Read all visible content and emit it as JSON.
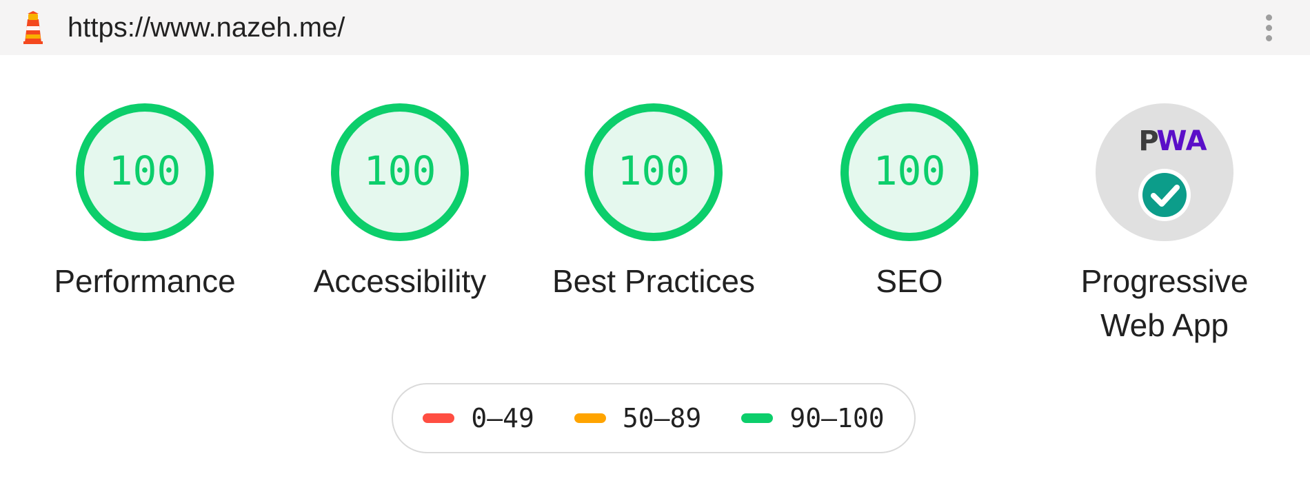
{
  "header": {
    "url": "https://www.nazeh.me/",
    "logo_icon": "lighthouse-icon",
    "menu_icon": "more-vertical-icon"
  },
  "colors": {
    "pass": "#0cce6b",
    "pass_fill": "#e5f8ee",
    "average": "#ffa400",
    "fail": "#ff4e42",
    "pwa_gray": "#e0e0e0"
  },
  "gauges": [
    {
      "label": "Performance",
      "score": "100"
    },
    {
      "label": "Accessibility",
      "score": "100"
    },
    {
      "label": "Best Practices",
      "score": "100"
    },
    {
      "label": "SEO",
      "score": "100"
    }
  ],
  "pwa": {
    "label_line1": "Progressive",
    "label_line2": "Web App",
    "badge_text_p": "P",
    "badge_text_wa": "WA",
    "status_icon": "checkmark-circle-icon"
  },
  "legend": [
    {
      "range": "0–49",
      "color": "#ff4e42"
    },
    {
      "range": "50–89",
      "color": "#ffa400"
    },
    {
      "range": "90–100",
      "color": "#0cce6b"
    }
  ]
}
